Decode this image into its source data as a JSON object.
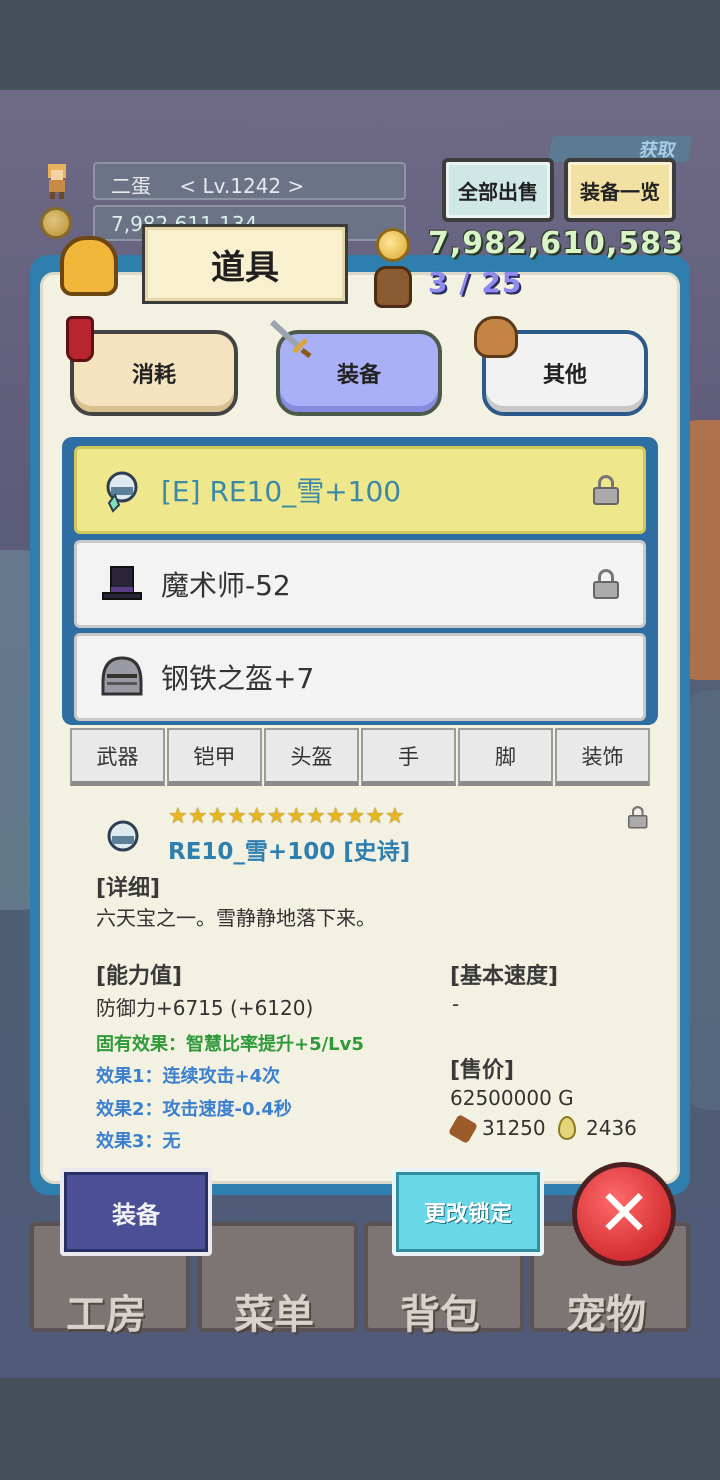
{
  "player": {
    "name": "二蛋",
    "level": "< Lv.1242 >",
    "gold_small": "7,982,611,134"
  },
  "header": {
    "sell_all": "全部出售",
    "equip_list": "装备一览",
    "get_tag": "获取",
    "gold": "7,982,610,583",
    "capacity": "3 / 25"
  },
  "panel": {
    "title": "道具"
  },
  "categories": [
    {
      "label": "消耗"
    },
    {
      "label": "装备"
    },
    {
      "label": "其他"
    }
  ],
  "items": [
    {
      "label": "[E] RE10_雪+100",
      "locked": true,
      "selected": true
    },
    {
      "label": "魔术师-52",
      "locked": true
    },
    {
      "label": "钢铁之盔+7",
      "locked": false
    }
  ],
  "filters": [
    "武器",
    "铠甲",
    "头盔",
    "手",
    "脚",
    "装饰"
  ],
  "detail": {
    "stars": "★★★★★★★★★★★★",
    "name": "RE10_雪+100 [史诗]",
    "desc_title": "[详细]",
    "desc": "六天宝之一。雪静静地落下来。",
    "stats_title": "[能力值]",
    "stat_defense": "防御力+6715 (+6120)",
    "innate": "固有效果：智慧比率提升+5/Lv5",
    "effect1": "效果1：连续攻击+4次",
    "effect2": "效果2：攻击速度-0.4秒",
    "effect3": "效果3：无",
    "speed_title": "[基本速度]",
    "speed_value": "-",
    "price_title": "[售价]",
    "price": "62500000 G",
    "mat1": "31250",
    "mat2": "2436"
  },
  "actions": {
    "equip": "装备",
    "change_lock": "更改锁定",
    "close": "✕"
  },
  "menu": [
    "工房",
    "菜单",
    "背包",
    "宠物"
  ],
  "colors": {
    "panel_blue": "#2f7fae",
    "selected_yellow": "#efe78b",
    "equip_tab": "#aab0f6",
    "close_red": "#c2181d"
  }
}
